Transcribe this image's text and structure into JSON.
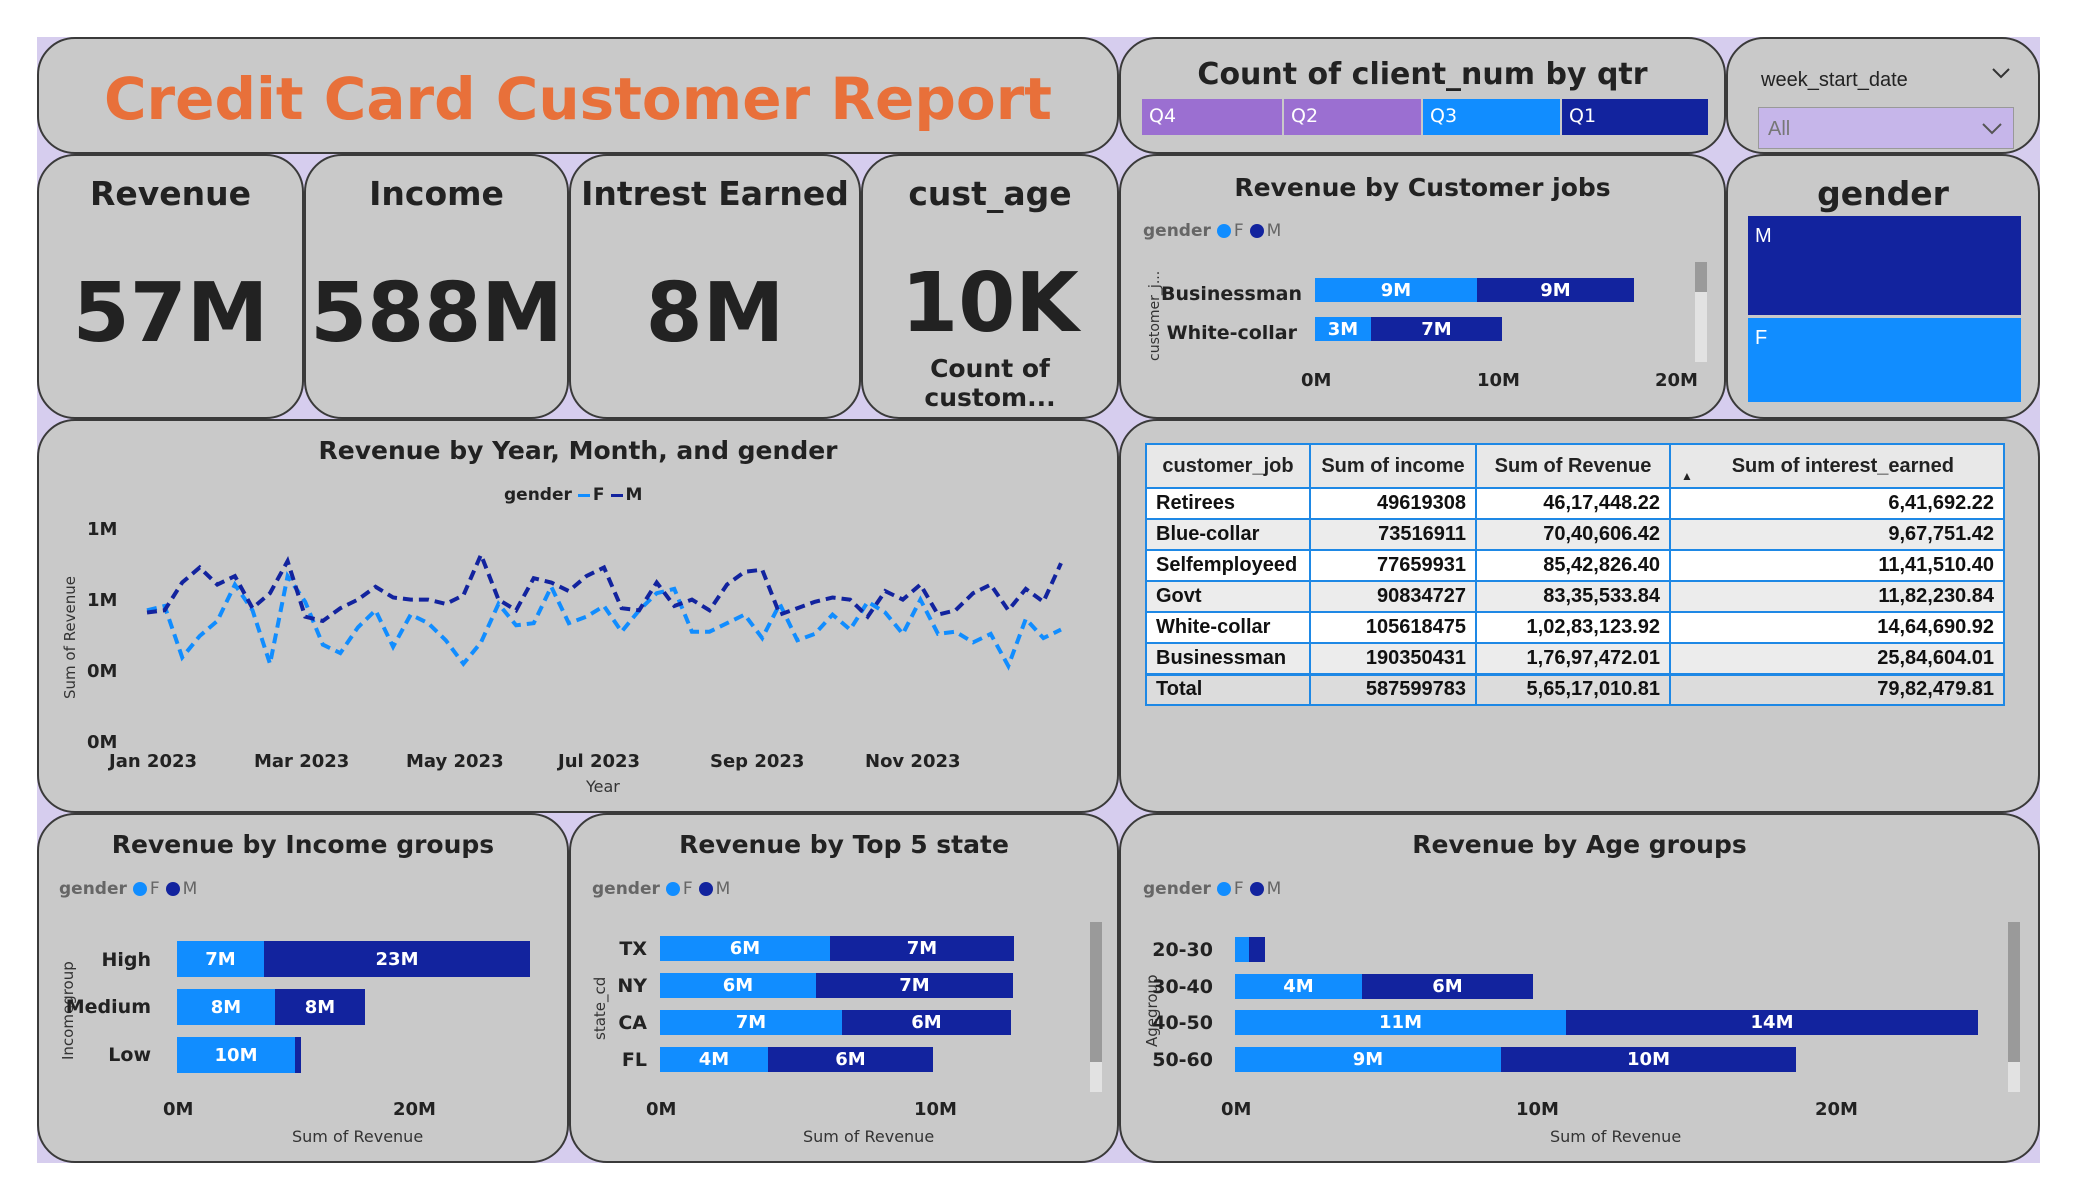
{
  "colors": {
    "F": "#118dff",
    "M": "#12239e",
    "title": "#e8703a",
    "q4": "#9b6fd1",
    "q3": "#118dff",
    "q1": "#12239e"
  },
  "title": "Credit Card Customer Report",
  "qtr": {
    "title": "Count of client_num by qtr",
    "items": [
      "Q4",
      "Q2",
      "Q3",
      "Q1"
    ]
  },
  "slicer": {
    "label": "week_start_date",
    "value": "All"
  },
  "kpis": {
    "revenue": {
      "label": "Revenue",
      "value": "57M"
    },
    "income": {
      "label": "Income",
      "value": "588M"
    },
    "interest": {
      "label": "Intrest Earned",
      "value": "8M"
    },
    "age": {
      "label": "cust_age",
      "value": "10K",
      "sub": "Count of custom..."
    }
  },
  "jobs_chart": {
    "title": "Revenue by Customer jobs",
    "legend_title": "gender",
    "legend": [
      "F",
      "M"
    ],
    "ylabel": "customer_j...",
    "ticks": [
      "0M",
      "10M",
      "20M"
    ],
    "rows": [
      {
        "label": "Businessman",
        "f": "9M",
        "m": "9M"
      },
      {
        "label": "White-collar",
        "f": "3M",
        "m": "7M"
      }
    ]
  },
  "gender_slicer": {
    "title": "gender",
    "items": [
      "M",
      "F"
    ]
  },
  "line_chart": {
    "title": "Revenue by Year, Month, and gender",
    "legend_title": "gender",
    "legend": [
      "F",
      "M"
    ],
    "yticks": [
      "1M",
      "1M",
      "0M",
      "0M"
    ],
    "xticks": [
      "Jan 2023",
      "Mar 2023",
      "May 2023",
      "Jul 2023",
      "Sep 2023",
      "Nov 2023"
    ],
    "xlabel": "Year",
    "ylabel": "Sum of Revenue"
  },
  "table": {
    "headers": [
      "customer_job",
      "Sum of income",
      "Sum of Revenue",
      "Sum of interest_earned"
    ],
    "rows": [
      [
        "Retirees",
        "49619308",
        "46,17,448.22",
        "6,41,692.22"
      ],
      [
        "Blue-collar",
        "73516911",
        "70,40,606.42",
        "9,67,751.42"
      ],
      [
        "Selfemployeed",
        "77659931",
        "85,42,826.40",
        "11,41,510.40"
      ],
      [
        "Govt",
        "90834727",
        "83,35,533.84",
        "11,82,230.84"
      ],
      [
        "White-collar",
        "105618475",
        "1,02,83,123.92",
        "14,64,690.92"
      ],
      [
        "Businessman",
        "190350431",
        "1,76,97,472.01",
        "25,84,604.01"
      ]
    ],
    "total": [
      "Total",
      "587599783",
      "5,65,17,010.81",
      "79,82,479.81"
    ]
  },
  "income_chart": {
    "title": "Revenue by Income groups",
    "legend_title": "gender",
    "legend": [
      "F",
      "M"
    ],
    "ylabel": "Incomegroup",
    "xlabel": "Sum of Revenue",
    "ticks": [
      "0M",
      "20M"
    ],
    "rows": [
      {
        "label": "High",
        "f": "7M",
        "m": "23M"
      },
      {
        "label": "Medium",
        "f": "8M",
        "m": "8M"
      },
      {
        "label": "Low",
        "f": "10M",
        "m": ""
      }
    ]
  },
  "state_chart": {
    "title": "Revenue by Top 5 state",
    "legend_title": "gender",
    "legend": [
      "F",
      "M"
    ],
    "ylabel": "state_cd",
    "xlabel": "Sum of Revenue",
    "ticks": [
      "0M",
      "10M"
    ],
    "rows": [
      {
        "label": "TX",
        "f": "6M",
        "m": "7M"
      },
      {
        "label": "NY",
        "f": "6M",
        "m": "7M"
      },
      {
        "label": "CA",
        "f": "7M",
        "m": "6M"
      },
      {
        "label": "FL",
        "f": "4M",
        "m": "6M"
      }
    ]
  },
  "age_chart": {
    "title": "Revenue by Age groups",
    "legend_title": "gender",
    "legend": [
      "F",
      "M"
    ],
    "ylabel": "Agegroup",
    "xlabel": "Sum of Revenue",
    "ticks": [
      "0M",
      "10M",
      "20M"
    ],
    "rows": [
      {
        "label": "20-30",
        "f": "",
        "m": ""
      },
      {
        "label": "30-40",
        "f": "4M",
        "m": "6M"
      },
      {
        "label": "40-50",
        "f": "11M",
        "m": "14M"
      },
      {
        "label": "50-60",
        "f": "9M",
        "m": "10M"
      }
    ]
  },
  "chart_data": [
    {
      "type": "bar",
      "title": "Revenue by Customer jobs",
      "stacked": true,
      "orientation": "horizontal",
      "categories": [
        "Businessman",
        "White-collar"
      ],
      "xlim": [
        0,
        20
      ],
      "series": [
        {
          "name": "F",
          "values": [
            9,
            3
          ]
        },
        {
          "name": "M",
          "values": [
            9,
            7
          ]
        }
      ]
    },
    {
      "type": "line",
      "title": "Revenue by Year, Month, and gender",
      "xlabel": "Year",
      "ylabel": "Sum of Revenue",
      "x": [
        "Jan 2023",
        "Dec 2023"
      ],
      "points_per_series": 53,
      "series": [
        {
          "name": "F",
          "values": [
            0.62,
            0.64,
            0.4,
            0.5,
            0.57,
            0.74,
            0.62,
            0.37,
            0.78,
            0.66,
            0.46,
            0.42,
            0.54,
            0.62,
            0.45,
            0.6,
            0.56,
            0.48,
            0.37,
            0.47,
            0.65,
            0.55,
            0.56,
            0.73,
            0.56,
            0.59,
            0.64,
            0.52,
            0.62,
            0.7,
            0.72,
            0.52,
            0.52,
            0.56,
            0.6,
            0.49,
            0.65,
            0.48,
            0.51,
            0.6,
            0.53,
            0.66,
            0.61,
            0.51,
            0.67,
            0.51,
            0.52,
            0.47,
            0.51,
            0.36,
            0.58,
            0.49,
            0.53
          ]
        },
        {
          "name": "M",
          "values": [
            0.61,
            0.62,
            0.75,
            0.82,
            0.74,
            0.78,
            0.63,
            0.7,
            0.85,
            0.59,
            0.57,
            0.63,
            0.67,
            0.73,
            0.68,
            0.67,
            0.67,
            0.65,
            0.69,
            0.88,
            0.67,
            0.62,
            0.77,
            0.75,
            0.71,
            0.78,
            0.82,
            0.63,
            0.62,
            0.75,
            0.64,
            0.67,
            0.62,
            0.74,
            0.8,
            0.81,
            0.6,
            0.63,
            0.66,
            0.68,
            0.67,
            0.59,
            0.71,
            0.67,
            0.74,
            0.6,
            0.62,
            0.7,
            0.74,
            0.62,
            0.72,
            0.66,
            0.84
          ]
        }
      ]
    },
    {
      "type": "bar",
      "title": "Revenue by Income groups",
      "stacked": true,
      "orientation": "horizontal",
      "categories": [
        "High",
        "Medium",
        "Low"
      ],
      "xlim": [
        0,
        30
      ],
      "series": [
        {
          "name": "F",
          "values": [
            7,
            8,
            10
          ]
        },
        {
          "name": "M",
          "values": [
            23,
            8,
            0.3
          ]
        }
      ]
    },
    {
      "type": "bar",
      "title": "Revenue by Top 5 state",
      "stacked": true,
      "orientation": "horizontal",
      "categories": [
        "TX",
        "NY",
        "CA",
        "FL"
      ],
      "xlim": [
        0,
        15
      ],
      "series": [
        {
          "name": "F",
          "values": [
            6,
            6,
            7,
            4
          ]
        },
        {
          "name": "M",
          "values": [
            7,
            7,
            6,
            6
          ]
        }
      ]
    },
    {
      "type": "bar",
      "title": "Revenue by Age groups",
      "stacked": true,
      "orientation": "horizontal",
      "categories": [
        "20-30",
        "30-40",
        "40-50",
        "50-60"
      ],
      "xlim": [
        0,
        27
      ],
      "series": [
        {
          "name": "F",
          "values": [
            0.5,
            4,
            11,
            9
          ]
        },
        {
          "name": "M",
          "values": [
            0.5,
            6,
            14,
            10
          ]
        }
      ]
    }
  ]
}
